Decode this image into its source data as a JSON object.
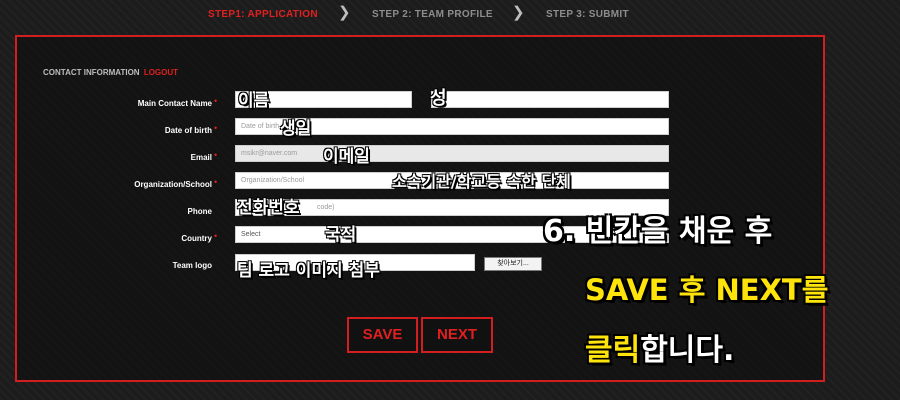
{
  "steps": [
    {
      "label": "STEP1: APPLICATION",
      "state": "active"
    },
    {
      "label": "STEP 2: TEAM PROFILE",
      "state": "inactive"
    },
    {
      "label": "STEP 3: SUBMIT",
      "state": "inactive"
    }
  ],
  "contact": {
    "header": "CONTACT INFORMATION",
    "logout": "LOGOUT"
  },
  "form": {
    "main_contact_label": "Main Contact Name",
    "date_of_birth_label": "Date of birth",
    "date_of_birth_placeholder": "Date of birth",
    "email_label": "Email",
    "email_value": "msikr@naver.com",
    "organization_label": "Organization/School",
    "organization_placeholder": "Organization/School",
    "phone_label": "Phone",
    "phone_placeholder_visible": "code)",
    "country_label": "Country",
    "country_selected": "Select",
    "team_logo_label": "Team logo",
    "file_button": "찾아보기..."
  },
  "annotations": {
    "first_name": "이름",
    "last_name": "성",
    "birth": "생일",
    "email": "이메일",
    "organization": "소속기관/학교등 속한 단체",
    "phone": "전화번호",
    "country": "국적",
    "team_logo": "팀 로고 이미지 첨부"
  },
  "buttons": {
    "save": "SAVE",
    "next": "NEXT"
  },
  "instruction": {
    "line1": "6. 빈칸을 채운 후",
    "line2": "SAVE 후 NEXT를",
    "line3_highlight": "클릭",
    "line3_rest": "합니다."
  },
  "colors": {
    "accent_red": "#e02020",
    "highlight_yellow": "#ffe40b",
    "background": "#1c1c1c"
  }
}
